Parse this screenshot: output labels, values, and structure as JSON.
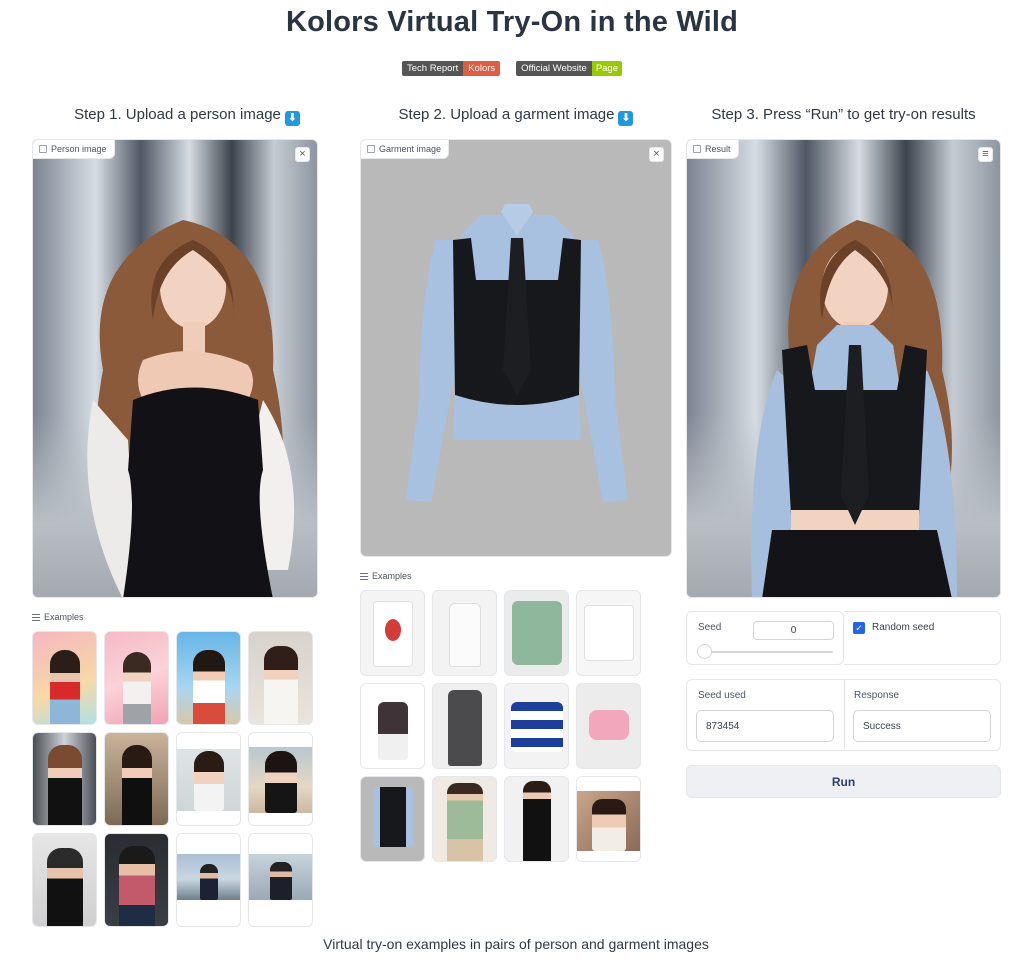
{
  "title": "Kolors Virtual Try-On in the Wild",
  "badges": [
    {
      "left": "Tech Report",
      "right": "Kolors"
    },
    {
      "left": "Official Website",
      "right": "Page"
    }
  ],
  "steps": [
    "Step 1. Upload a person image",
    "Step 2. Upload a garment image",
    "Step 3. Press “Run” to get try-on results"
  ],
  "person_image": {
    "label": "Person image",
    "close": "×"
  },
  "garment_image": {
    "label": "Garment image",
    "close": "×"
  },
  "result_image": {
    "label": "Result",
    "menu": "≡"
  },
  "examples_label": "Examples",
  "seed": {
    "label": "Seed",
    "value": "0",
    "slider_fraction": 0
  },
  "random_seed": {
    "label": "Random seed",
    "checked": true,
    "check": "✓"
  },
  "seed_used": {
    "label": "Seed used",
    "value": "873454"
  },
  "response": {
    "label": "Response",
    "value": "Success"
  },
  "run_label": "Run",
  "footer": "Virtual try-on examples in pairs of person and garment images",
  "colors": {
    "accent_blue": "#2563eb",
    "badge_red": "#e05d44",
    "badge_green": "#97ca00",
    "badge_gray": "#555555",
    "download_icon": "#1f9ae0"
  }
}
